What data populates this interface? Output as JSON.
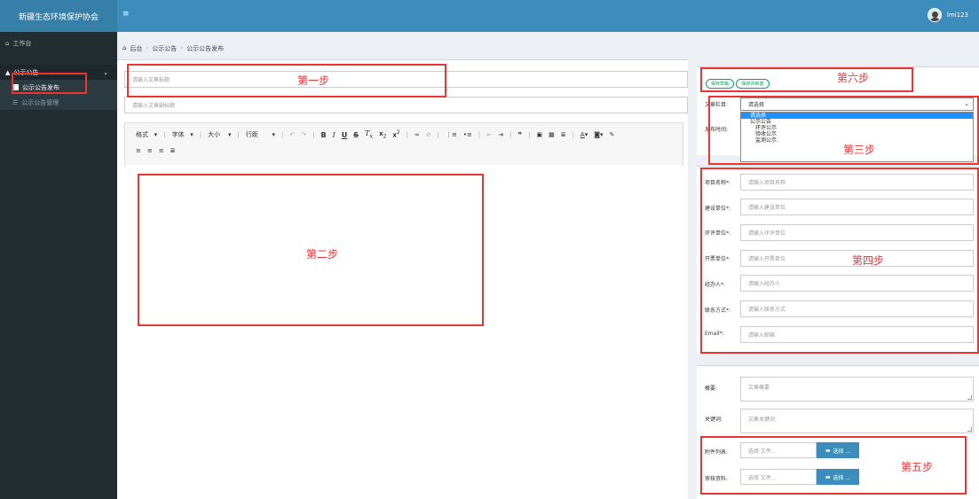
{
  "header": {
    "brand": "新疆生态环境保护协会",
    "menu_toggle": "≡",
    "user": "lmi123"
  },
  "sidebar": {
    "workbench": "工作台",
    "group": "公示公告",
    "items": [
      {
        "label": "公示公告发布"
      },
      {
        "label": "公示公告管理"
      }
    ]
  },
  "breadcrumb": {
    "home": "后台",
    "section": "公示公告",
    "page": "公示公告发布"
  },
  "article": {
    "title_placeholder": "请输入文章标题",
    "subtitle_placeholder": "请输入文章副标题"
  },
  "editor": {
    "format": "格式",
    "font": "字体",
    "size": "大小",
    "line_height": "行距"
  },
  "publish": {
    "save_draft": "保存草稿",
    "save_new": "保存并新建",
    "column_label": "文章栏目:",
    "column_value": "请选择",
    "time_label": "发布时间:",
    "options": [
      {
        "label": "请选择"
      },
      {
        "label": "公示公告"
      },
      {
        "label": "环评公示"
      },
      {
        "label": "验收公示"
      },
      {
        "label": "监测公示"
      }
    ]
  },
  "form": {
    "fields": [
      {
        "label": "项目名称*:",
        "placeholder": "请输入项目名称"
      },
      {
        "label": "建设单位*:",
        "placeholder": "请输入建设单位"
      },
      {
        "label": "环评单位*:",
        "placeholder": "请输入环评单位"
      },
      {
        "label": "开票单位*:",
        "placeholder": "请输入开票单位"
      },
      {
        "label": "经办人*:",
        "placeholder": "请输入经办人"
      },
      {
        "label": "联系方式*:",
        "placeholder": "请输入联系方式"
      },
      {
        "label": "Email*:",
        "placeholder": "请输入邮箱"
      }
    ]
  },
  "extra": {
    "summary_label": "概要:",
    "summary_placeholder": "文章概要",
    "keywords_label": "关键词:",
    "keywords_placeholder": "文章关键词",
    "attachments_label": "附件列表:",
    "review_label": "审核资料:",
    "file_placeholder": "选择 文件...",
    "choose_label": "选择 ..."
  },
  "annotations": {
    "step1": "第一步",
    "step2": "第二步",
    "step3": "第三步",
    "step4": "第四步",
    "step5": "第五步",
    "step6": "第六步"
  },
  "colors": {
    "header": "#3c8dbc",
    "sidebar": "#222d32",
    "annotation": "#e33333",
    "success": "#00a65a"
  }
}
